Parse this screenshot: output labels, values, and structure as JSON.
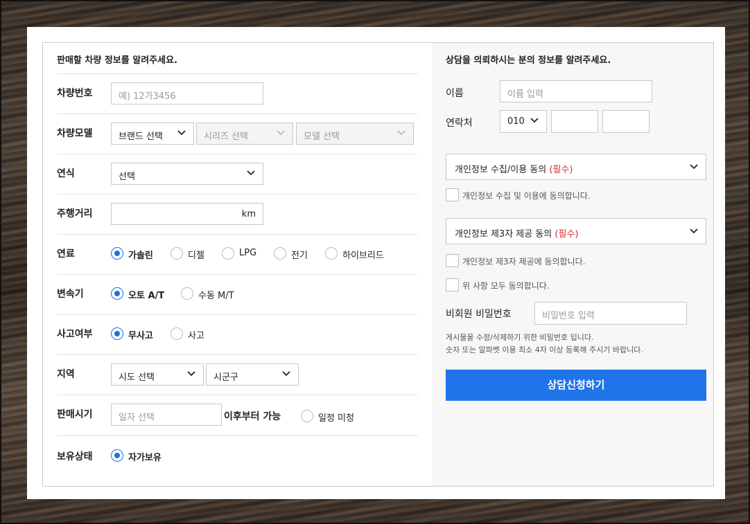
{
  "vehicle": {
    "title": "판매할 차량 정보를 알려주세요.",
    "plate": {
      "label": "차량번호",
      "placeholder": "예) 12가3456"
    },
    "model": {
      "label": "차량모델",
      "brand": "브랜드 선택",
      "series": "시리즈 선택",
      "model": "모델 선택"
    },
    "year": {
      "label": "연식",
      "value": "선택"
    },
    "mileage": {
      "label": "주행거리",
      "unit": "km"
    },
    "fuel": {
      "label": "연료",
      "options": [
        "가솔린",
        "디젤",
        "LPG",
        "전기",
        "하이브리드"
      ],
      "selected": "가솔린"
    },
    "transmission": {
      "label": "변속기",
      "options": [
        "오토 A/T",
        "수동 M/T"
      ],
      "selected": "오토 A/T"
    },
    "accident": {
      "label": "사고여부",
      "options": [
        "무사고",
        "사고"
      ],
      "selected": "무사고"
    },
    "region": {
      "label": "지역",
      "sido": "시도 선택",
      "sigungu": "시군구"
    },
    "sale_time": {
      "label": "판매시기",
      "placeholder": "일자 선택",
      "after_text": "이후부터 가능",
      "undecided": "일정 미정"
    },
    "ownership": {
      "label": "보유상태",
      "option": "자가보유"
    }
  },
  "contact": {
    "title": "상담을 의뢰하시는 분의 정보를 알려주세요.",
    "name": {
      "label": "이름",
      "placeholder": "이름 입력"
    },
    "phone": {
      "label": "연락처",
      "prefix": "010"
    },
    "privacy1": {
      "title": "개인정보 수집/이용 동의",
      "required": "(필수)",
      "check": "개인정보 수집 및 이용에 동의합니다."
    },
    "privacy2": {
      "title": "개인정보 제3자 제공 동의",
      "required": "(필수)",
      "check": "개인정보 제3자 제공에 동의합니다."
    },
    "agree_all": "위 사항 모두 동의합니다.",
    "password": {
      "label": "비회원 비밀번호",
      "placeholder": "비밀번호 입력"
    },
    "note1": "게시물을 수정/삭제하기 위한 비밀번호 입니다.",
    "note2": "숫자 또는 알파벳 이용 최소 4자 이상 등록해 주시기 바랍니다.",
    "submit": "상담신청하기"
  },
  "colors": {
    "accent": "#1f74ea",
    "required": "#d0322d"
  }
}
